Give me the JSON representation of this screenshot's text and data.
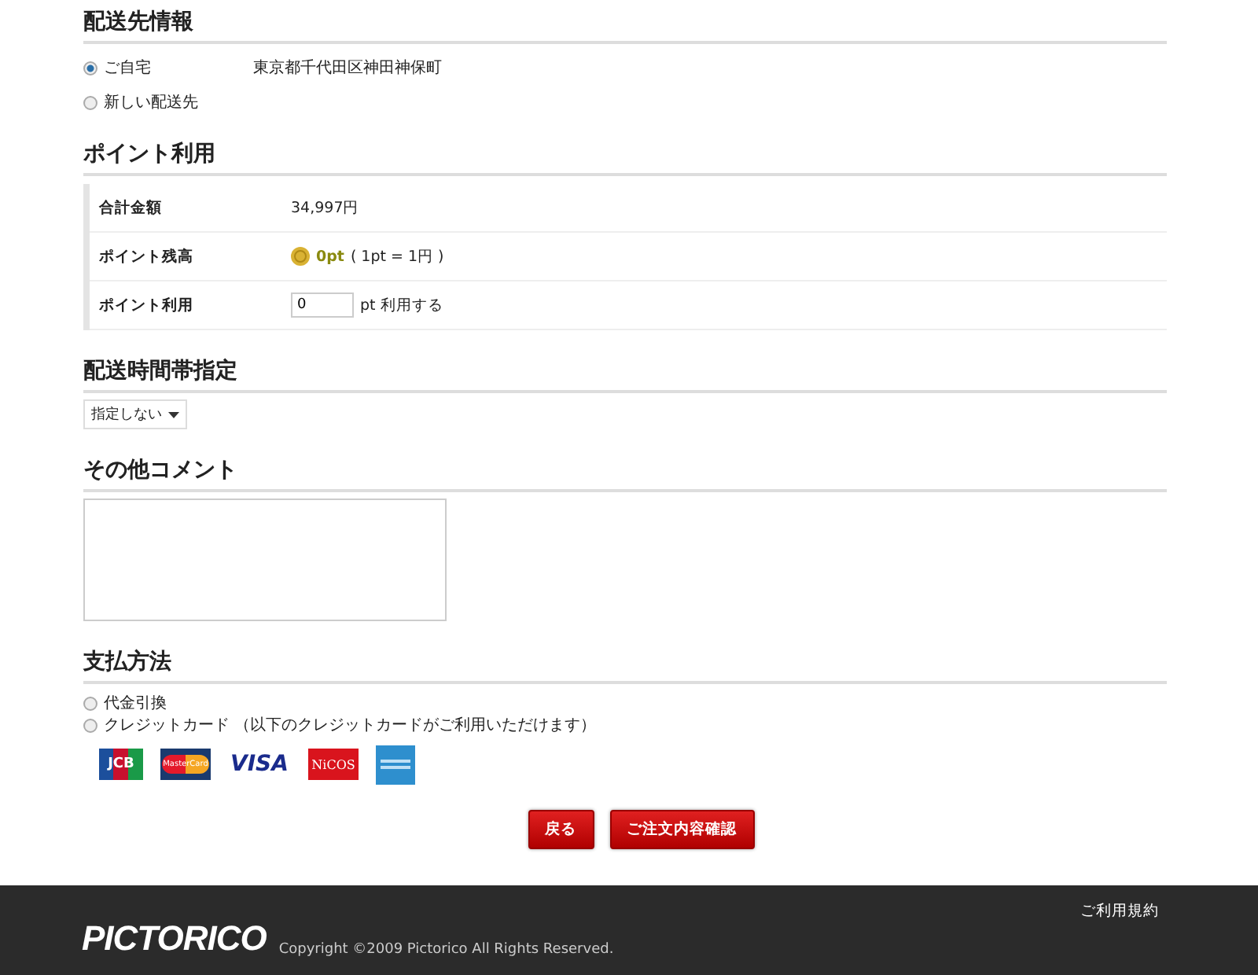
{
  "delivery": {
    "heading": "配送先情報",
    "options": [
      {
        "label": "ご自宅",
        "address": "東京都千代田区神田神保町",
        "selected": true
      },
      {
        "label": "新しい配送先",
        "selected": false
      }
    ]
  },
  "points": {
    "heading": "ポイント利用",
    "rows": [
      {
        "kind": "text",
        "label": "合計金額",
        "value": "34,997円"
      },
      {
        "kind": "balance",
        "label": "ポイント残高",
        "value": "0pt",
        "note": "( 1pt = 1円 )"
      },
      {
        "kind": "input",
        "label": "ポイント利用",
        "value": "0",
        "suffix": "pt 利用する"
      }
    ]
  },
  "delivery_time": {
    "heading": "配送時間帯指定",
    "select": "指定しない"
  },
  "comment": {
    "heading": "その他コメント"
  },
  "payment": {
    "heading": "支払方法",
    "options": [
      {
        "label": "代金引換",
        "selected": false
      },
      {
        "label": "クレジットカード （以下のクレジットカードがご利用いただけます）",
        "selected": false
      }
    ],
    "cards": [
      {
        "kind": "jcb",
        "text": "JCB"
      },
      {
        "kind": "master",
        "text": "MasterCard"
      },
      {
        "kind": "visa",
        "text": "VISA"
      },
      {
        "kind": "nicos",
        "text": "NiCOS"
      },
      {
        "kind": "amex"
      }
    ]
  },
  "buttons": [
    {
      "label": "戻る"
    },
    {
      "label": "ご注文内容確認"
    }
  ],
  "footer": {
    "logo": "PICTORICO",
    "copyright": "Copyright ©2009 Pictorico All Rights Reserved.",
    "link": "ご利用規約"
  }
}
